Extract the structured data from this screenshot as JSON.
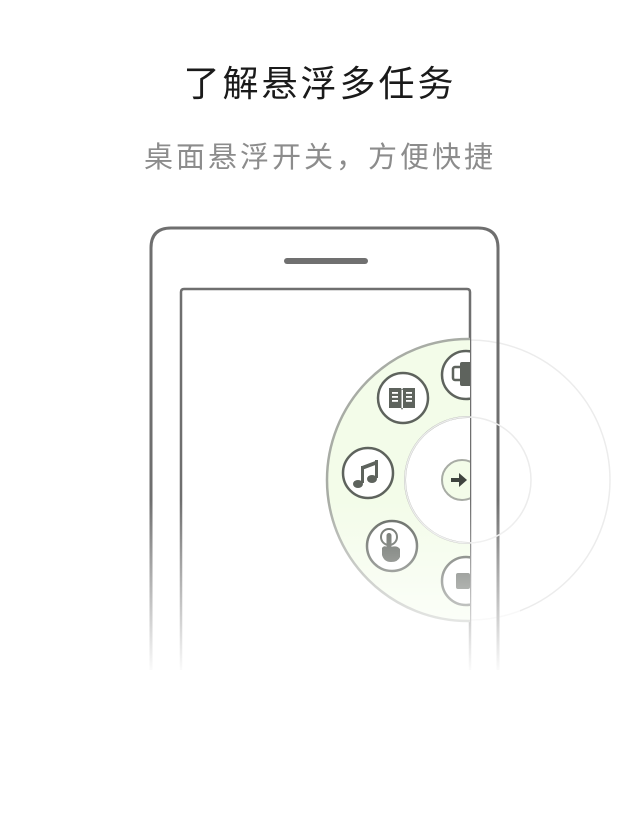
{
  "header": {
    "title": "了解悬浮多任务",
    "subtitle": "桌面悬浮开关，方便快捷"
  },
  "illustration": {
    "phone_outline_color": "#6f6f6f",
    "menu_fill_color": "#f3fce9",
    "menu_border_color": "#a8aca5",
    "icon_color": "#5e635d",
    "icons": [
      "book-icon",
      "music-note-icon",
      "touch-hand-icon",
      "arrow-right-icon",
      "puzzle-icon",
      "square-icon"
    ]
  }
}
